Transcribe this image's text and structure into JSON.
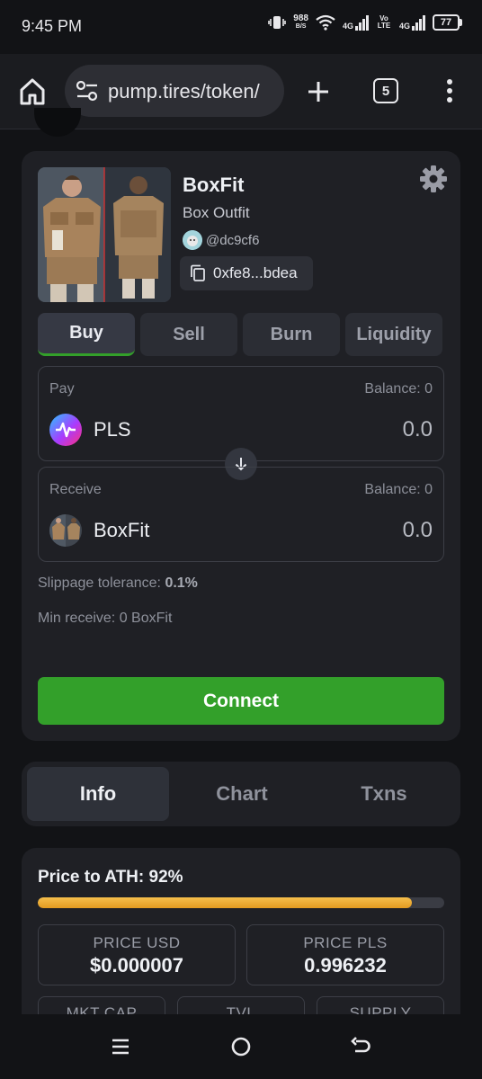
{
  "status_bar": {
    "time": "9:45 PM",
    "net_speed": "988",
    "net_speed_unit": "B/S",
    "sim1": "4G",
    "volte": "Vo LTE",
    "sim2": "4G",
    "battery": "77"
  },
  "browser": {
    "url": "pump.tires/token/",
    "tab_count": "5"
  },
  "token": {
    "name": "BoxFit",
    "description": "Box Outfit",
    "creator": "@dc9cf6",
    "address": "0xfe8...bdea"
  },
  "trade": {
    "tabs": [
      "Buy",
      "Sell",
      "Burn",
      "Liquidity"
    ],
    "active_tab": "Buy",
    "pay": {
      "label": "Pay",
      "balance": "Balance: 0",
      "token": "PLS",
      "amount": "0.0"
    },
    "receive": {
      "label": "Receive",
      "balance": "Balance: 0",
      "token": "BoxFit",
      "amount": "0.0"
    },
    "slippage_label": "Slippage tolerance:",
    "slippage_value": "0.1%",
    "min_receive": "Min receive: 0 BoxFit",
    "connect_label": "Connect"
  },
  "section_tabs": [
    "Info",
    "Chart",
    "Txns"
  ],
  "info": {
    "ath_label": "Price to ATH: 92%",
    "ath_progress": 0.92,
    "price_usd_label": "PRICE USD",
    "price_usd": "$0.000007",
    "price_pls_label": "PRICE PLS",
    "price_pls": "0.996232",
    "mkt_cap_label": "MKT CAP",
    "tvl_label": "TVL",
    "supply_label": "SUPPLY"
  },
  "colors": {
    "accent_green": "#33a02a",
    "progress_fill": "#f0a72e",
    "card_bg": "#1f2025",
    "page_bg": "#121316"
  },
  "icons": [
    "home-icon",
    "site-settings-icon",
    "plus-icon",
    "tabs-icon",
    "more-vert-icon",
    "gear-icon",
    "copy-icon",
    "arrow-down-icon",
    "nav-recents-icon",
    "nav-home-icon",
    "nav-back-icon"
  ]
}
